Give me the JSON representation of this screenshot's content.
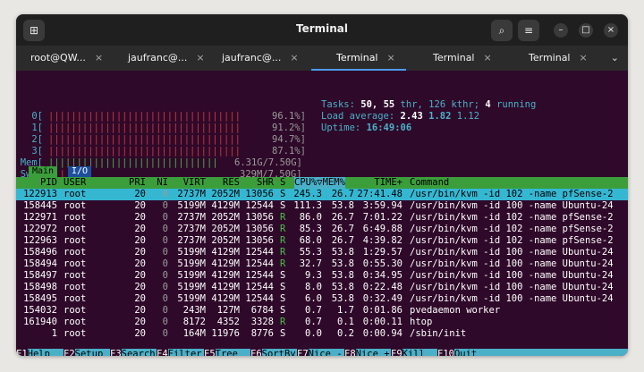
{
  "window": {
    "title": "Terminal",
    "new_tab_glyph": "⊞",
    "search_glyph": "⌕",
    "menu_glyph": "≡",
    "minimize_glyph": "–",
    "maximize_glyph": "□",
    "close_glyph": "×"
  },
  "tabs": [
    {
      "label": "root@QW...",
      "x": "×"
    },
    {
      "label": "jaufranc@...",
      "x": "×"
    },
    {
      "label": "jaufranc@...",
      "x": "×"
    },
    {
      "label": "Terminal",
      "x": "×"
    },
    {
      "label": "Terminal",
      "x": "×"
    },
    {
      "label": "Terminal",
      "x": "×"
    }
  ],
  "tab_chevron": "⌄",
  "meters": [
    {
      "label": "0[",
      "bar": "||||||||||||||||||||||||||||||||||",
      "value": "96.1%]"
    },
    {
      "label": "1[",
      "bar": "||||||||||||||||||||||||||||||||||",
      "value": "91.2%]"
    },
    {
      "label": "2[",
      "bar": "||||||||||||||||||||||||||||||||||",
      "value": "94.7%]"
    },
    {
      "label": "3[",
      "bar": "||||||||||||||||||||||||||||||||||",
      "value": "87.1%]"
    },
    {
      "label": "Mem[",
      "bar": "||||||||||||||||||||||||||||||",
      "value": "6.31G/7.50G]"
    },
    {
      "label": "Swp[",
      "bar": "|||",
      "value": "329M/7.50G]"
    }
  ],
  "summary": {
    "tasks_label": "Tasks:",
    "tasks_value": "50,",
    "threads_value": "55",
    "threads_label": "thr,",
    "kthr_value": "126",
    "kthr_label": "kthr;",
    "running_value": "4",
    "running_label": "running",
    "load_label": "Load average:",
    "load1": "2.43",
    "load5": "1.82",
    "load15": "1.12",
    "uptime_label": "Uptime:",
    "uptime_value": "16:49:06"
  },
  "screen_tabs": {
    "main": "Main",
    "io": "I/O"
  },
  "columns": [
    "PID",
    "USER",
    "PRI",
    "NI",
    "VIRT",
    "RES",
    "SHR",
    "S",
    "CPU%▽MEM%",
    "TIME+",
    "Command"
  ],
  "processes": [
    {
      "pid": "122913",
      "user": "root",
      "pri": "20",
      "ni": "0",
      "virt": "2737M",
      "res": "2052M",
      "shr": "13056",
      "s": "S",
      "cpu": "245.3",
      "mem": "26.7",
      "time": "27:41.48",
      "cmd": "/usr/bin/kvm -id 102 -name pfSense-2"
    },
    {
      "pid": "158445",
      "user": "root",
      "pri": "20",
      "ni": "0",
      "virt": "5199M",
      "res": "4129M",
      "shr": "12544",
      "s": "S",
      "cpu": "111.3",
      "mem": "53.8",
      "time": "3:59.94",
      "cmd": "/usr/bin/kvm -id 100 -name Ubuntu-24"
    },
    {
      "pid": "122971",
      "user": "root",
      "pri": "20",
      "ni": "0",
      "virt": "2737M",
      "res": "2052M",
      "shr": "13056",
      "s": "R",
      "cpu": "86.0",
      "mem": "26.7",
      "time": "7:01.22",
      "cmd": "/usr/bin/kvm -id 102 -name pfSense-2"
    },
    {
      "pid": "122972",
      "user": "root",
      "pri": "20",
      "ni": "0",
      "virt": "2737M",
      "res": "2052M",
      "shr": "13056",
      "s": "R",
      "cpu": "85.3",
      "mem": "26.7",
      "time": "6:49.88",
      "cmd": "/usr/bin/kvm -id 102 -name pfSense-2"
    },
    {
      "pid": "122963",
      "user": "root",
      "pri": "20",
      "ni": "0",
      "virt": "2737M",
      "res": "2052M",
      "shr": "13056",
      "s": "R",
      "cpu": "68.0",
      "mem": "26.7",
      "time": "4:39.82",
      "cmd": "/usr/bin/kvm -id 102 -name pfSense-2"
    },
    {
      "pid": "158496",
      "user": "root",
      "pri": "20",
      "ni": "0",
      "virt": "5199M",
      "res": "4129M",
      "shr": "12544",
      "s": "R",
      "cpu": "55.3",
      "mem": "53.8",
      "time": "1:29.57",
      "cmd": "/usr/bin/kvm -id 100 -name Ubuntu-24"
    },
    {
      "pid": "158494",
      "user": "root",
      "pri": "20",
      "ni": "0",
      "virt": "5199M",
      "res": "4129M",
      "shr": "12544",
      "s": "R",
      "cpu": "32.7",
      "mem": "53.8",
      "time": "0:55.30",
      "cmd": "/usr/bin/kvm -id 100 -name Ubuntu-24"
    },
    {
      "pid": "158497",
      "user": "root",
      "pri": "20",
      "ni": "0",
      "virt": "5199M",
      "res": "4129M",
      "shr": "12544",
      "s": "S",
      "cpu": "9.3",
      "mem": "53.8",
      "time": "0:34.95",
      "cmd": "/usr/bin/kvm -id 100 -name Ubuntu-24"
    },
    {
      "pid": "158498",
      "user": "root",
      "pri": "20",
      "ni": "0",
      "virt": "5199M",
      "res": "4129M",
      "shr": "12544",
      "s": "S",
      "cpu": "8.0",
      "mem": "53.8",
      "time": "0:22.48",
      "cmd": "/usr/bin/kvm -id 100 -name Ubuntu-24"
    },
    {
      "pid": "158495",
      "user": "root",
      "pri": "20",
      "ni": "0",
      "virt": "5199M",
      "res": "4129M",
      "shr": "12544",
      "s": "S",
      "cpu": "6.0",
      "mem": "53.8",
      "time": "0:32.49",
      "cmd": "/usr/bin/kvm -id 100 -name Ubuntu-24"
    },
    {
      "pid": "154032",
      "user": "root",
      "pri": "20",
      "ni": "0",
      "virt": "243M",
      "res": "127M",
      "shr": "6784",
      "s": "S",
      "cpu": "0.7",
      "mem": "1.7",
      "time": "0:01.86",
      "cmd": "pvedaemon worker"
    },
    {
      "pid": "161940",
      "user": "root",
      "pri": "20",
      "ni": "0",
      "virt": "8172",
      "res": "4352",
      "shr": "3328",
      "s": "R",
      "cpu": "0.7",
      "mem": "0.1",
      "time": "0:00.11",
      "cmd": "htop"
    },
    {
      "pid": "1",
      "user": "root",
      "pri": "20",
      "ni": "0",
      "virt": "164M",
      "res": "11976",
      "shr": "8776",
      "s": "S",
      "cpu": "0.0",
      "mem": "0.2",
      "time": "0:00.94",
      "cmd": "/sbin/init"
    }
  ],
  "fkeys": [
    {
      "k": "F1",
      "l": "Help"
    },
    {
      "k": "F2",
      "l": "Setup"
    },
    {
      "k": "F3",
      "l": "Search"
    },
    {
      "k": "F4",
      "l": "Filter"
    },
    {
      "k": "F5",
      "l": "Tree"
    },
    {
      "k": "F6",
      "l": "SortBy"
    },
    {
      "k": "F7",
      "l": "Nice -"
    },
    {
      "k": "F8",
      "l": "Nice +"
    },
    {
      "k": "F9",
      "l": "Kill"
    },
    {
      "k": "F10",
      "l": "Quit"
    }
  ]
}
